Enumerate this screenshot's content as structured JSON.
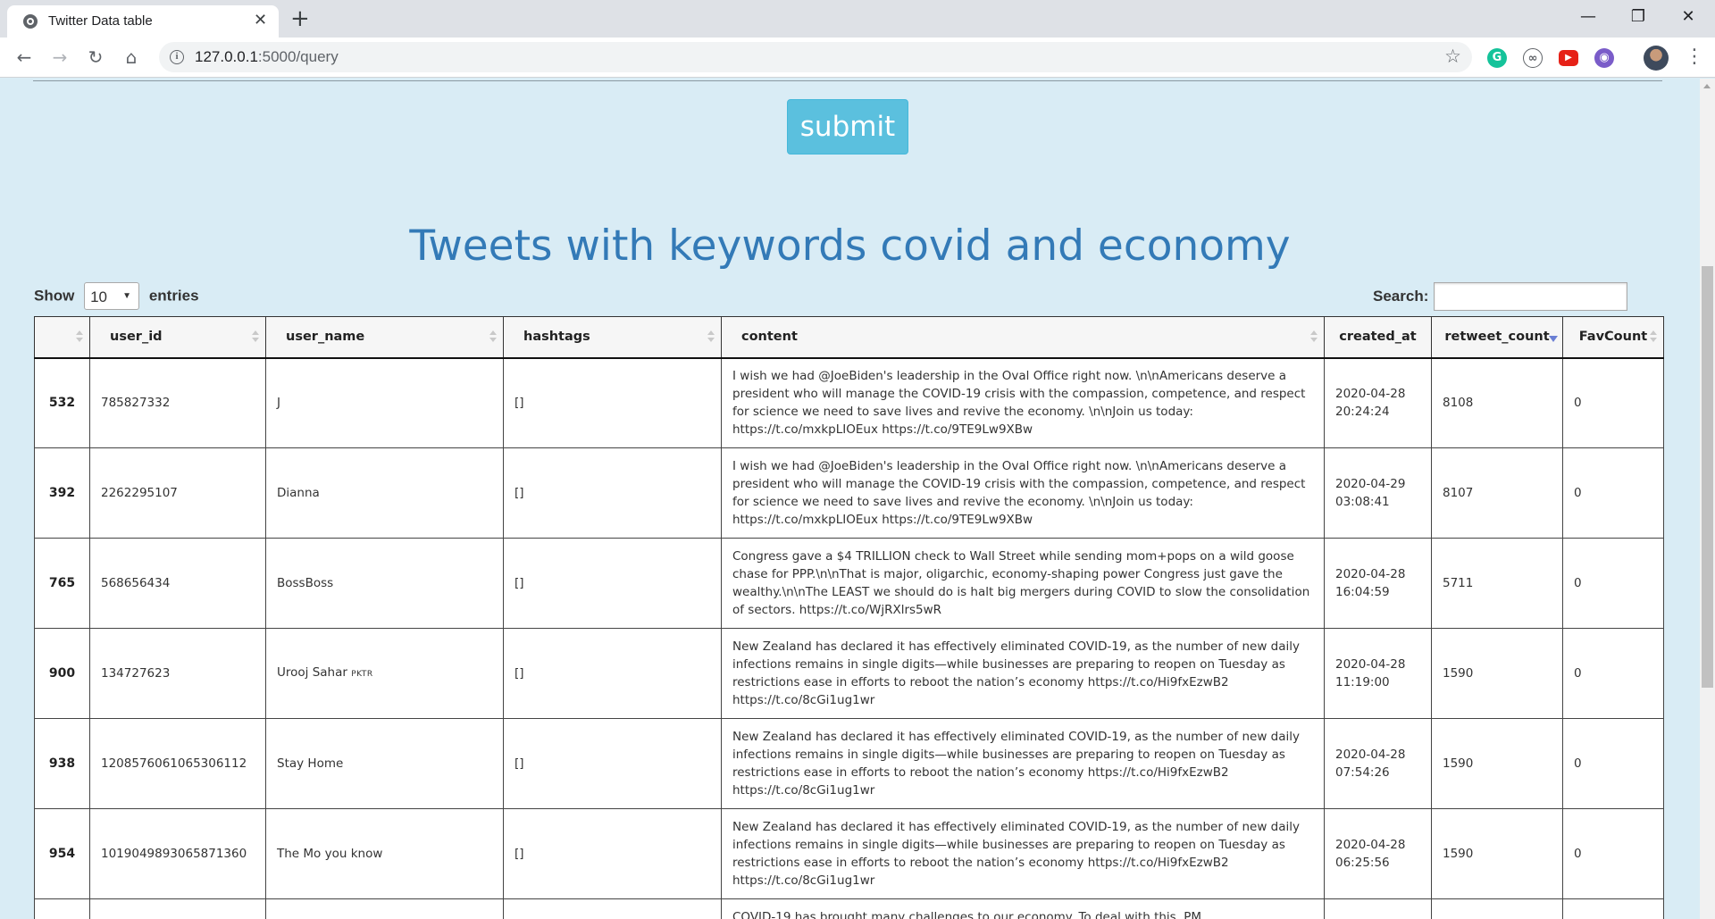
{
  "browser": {
    "tab_title": "Twitter Data table",
    "tab_close": "✕",
    "new_tab": "+",
    "url_host": "127.0.0.1",
    "url_path": ":5000/query",
    "window_controls": [
      "—",
      "❐",
      "✕"
    ]
  },
  "page": {
    "submit_label": "submit",
    "title": "Tweets with keywords covid and economy",
    "show_label": "Show",
    "entries_value": "10",
    "entries_label": "entries",
    "search_label": "Search:"
  },
  "table": {
    "columns": [
      "",
      "user_id",
      "user_name",
      "hashtags",
      "content",
      "created_at",
      "retweet_count",
      "FavCount"
    ],
    "sorted_column": "retweet_count",
    "rows": [
      {
        "idx": "532",
        "user_id": "785827332",
        "user_name": "J",
        "user_tag": "",
        "hashtags": "[]",
        "content": "I wish we had @JoeBiden's leadership in the Oval Office right now. \\n\\nAmericans deserve a president who will manage the COVID-19 crisis with the compassion, competence, and respect for science we need to save lives and revive the economy. \\n\\nJoin us today: https://t.co/mxkpLIOEux https://t.co/9TE9Lw9XBw",
        "created_date": "2020-04-28",
        "created_time": "20:24:24",
        "retweet_count": "8108",
        "fav_count": "0"
      },
      {
        "idx": "392",
        "user_id": "2262295107",
        "user_name": "Dianna",
        "user_tag": "",
        "hashtags": "[]",
        "content": "I wish we had @JoeBiden's leadership in the Oval Office right now. \\n\\nAmericans deserve a president who will manage the COVID-19 crisis with the compassion, competence, and respect for science we need to save lives and revive the economy. \\n\\nJoin us today: https://t.co/mxkpLIOEux https://t.co/9TE9Lw9XBw",
        "created_date": "2020-04-29",
        "created_time": "03:08:41",
        "retweet_count": "8107",
        "fav_count": "0"
      },
      {
        "idx": "765",
        "user_id": "568656434",
        "user_name": "BossBoss",
        "user_tag": "",
        "hashtags": "[]",
        "content": "Congress gave a $4 TRILLION check to Wall Street while sending mom+pops on a wild goose chase for PPP.\\n\\nThat is major, oligarchic, economy-shaping power Congress just gave the wealthy.\\n\\nThe LEAST we should do is halt big mergers during COVID to slow the consolidation of sectors. https://t.co/WjRXlrs5wR",
        "created_date": "2020-04-28",
        "created_time": "16:04:59",
        "retweet_count": "5711",
        "fav_count": "0"
      },
      {
        "idx": "900",
        "user_id": "134727623",
        "user_name": "Urooj Sahar",
        "user_tag": "PKTR",
        "hashtags": "[]",
        "content": "New Zealand has declared it has effectively eliminated COVID-19, as the number of new daily infections remains in single digits—while businesses are preparing to reopen on Tuesday as restrictions ease in efforts to reboot the nation’s economy https://t.co/Hi9fxEzwB2 https://t.co/8cGi1ug1wr",
        "created_date": "2020-04-28",
        "created_time": "11:19:00",
        "retweet_count": "1590",
        "fav_count": "0"
      },
      {
        "idx": "938",
        "user_id": "1208576061065306112",
        "user_name": "Stay Home",
        "user_tag": "",
        "hashtags": "[]",
        "content": "New Zealand has declared it has effectively eliminated COVID-19, as the number of new daily infections remains in single digits—while businesses are preparing to reopen on Tuesday as restrictions ease in efforts to reboot the nation’s economy https://t.co/Hi9fxEzwB2 https://t.co/8cGi1ug1wr",
        "created_date": "2020-04-28",
        "created_time": "07:54:26",
        "retweet_count": "1590",
        "fav_count": "0"
      },
      {
        "idx": "954",
        "user_id": "1019049893065871360",
        "user_name": "The Mo you know",
        "user_tag": "",
        "hashtags": "[]",
        "content": "New Zealand has declared it has effectively eliminated COVID-19, as the number of new daily infections remains in single digits—while businesses are preparing to reopen on Tuesday as restrictions ease in efforts to reboot the nation’s economy https://t.co/Hi9fxEzwB2 https://t.co/8cGi1ug1wr",
        "created_date": "2020-04-28",
        "created_time": "06:25:56",
        "retweet_count": "1590",
        "fav_count": "0"
      }
    ],
    "partial_row_content": "COVID-19 has brought many challenges to our economy. To deal with this, PM"
  }
}
